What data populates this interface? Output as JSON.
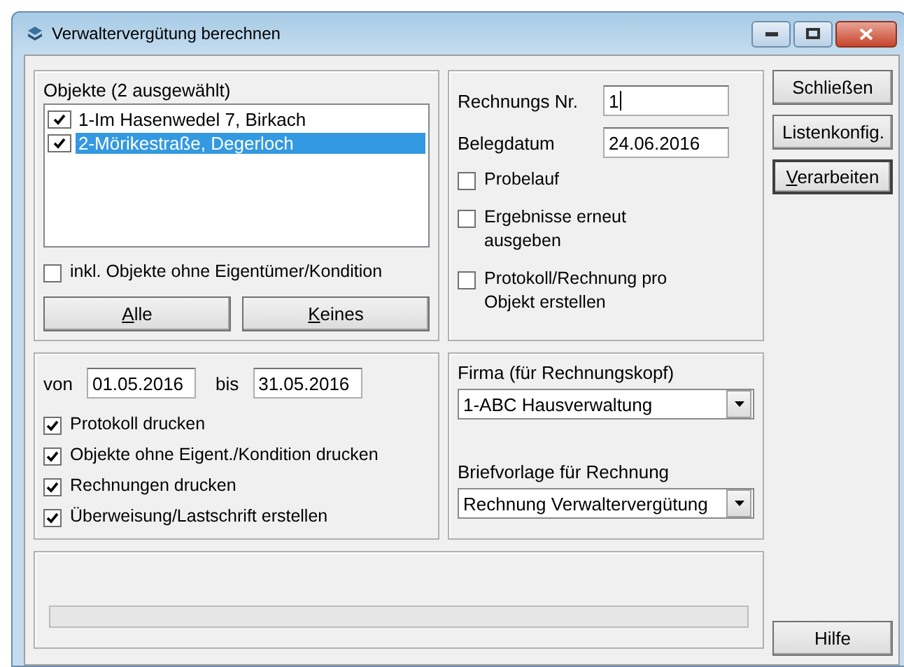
{
  "window": {
    "title": "Verwaltervergütung berechnen"
  },
  "objects": {
    "label": "Objekte (2 ausgewählt)",
    "items": [
      {
        "label": "1-Im Hasenwedel 7, Birkach",
        "checked": true,
        "selected": false
      },
      {
        "label": "2-Mörikestraße, Degerloch",
        "checked": true,
        "selected": true
      }
    ],
    "include_option": {
      "label": "inkl. Objekte ohne Eigentümer/Kondition",
      "checked": false
    },
    "buttons": [
      {
        "label": "Alle",
        "mnemonic": true
      },
      {
        "label": "Keines",
        "mnemonic": true
      }
    ]
  },
  "invoice": {
    "number_label": "Rechnungs Nr.",
    "number_value": "1",
    "date_label": "Belegdatum",
    "date_value": "24.06.2016",
    "options": [
      {
        "label": "Probelauf",
        "checked": false
      },
      {
        "label": "Ergebnisse erneut ausgeben",
        "checked": false
      },
      {
        "label": "Protokoll/Rechnung pro Objekt erstellen",
        "checked": false
      }
    ]
  },
  "period": {
    "from_label": "von",
    "from_value": "01.05.2016",
    "to_label": "bis",
    "to_value": "31.05.2016",
    "options": [
      {
        "label": "Protokoll drucken",
        "checked": true
      },
      {
        "label": "Objekte ohne Eigent./Kondition drucken",
        "checked": true
      },
      {
        "label": "Rechnungen drucken",
        "checked": true
      },
      {
        "label": "Überweisung/Lastschrift erstellen",
        "checked": true
      }
    ]
  },
  "company": {
    "label": "Firma (für Rechnungskopf)",
    "value": "1-ABC Hausverwaltung",
    "template_label": "Briefvorlage für Rechnung",
    "template_value": "Rechnung Verwaltervergütung"
  },
  "progress": {
    "level": 0
  },
  "side_buttons": [
    {
      "label": "Schließen",
      "mnemonic": false,
      "default": false
    },
    {
      "label": "Listenkonfig.",
      "mnemonic": false,
      "default": false
    },
    {
      "label": "Verarbeiten",
      "mnemonic": true,
      "default": true
    }
  ],
  "help_button": {
    "label": "Hilfe"
  }
}
